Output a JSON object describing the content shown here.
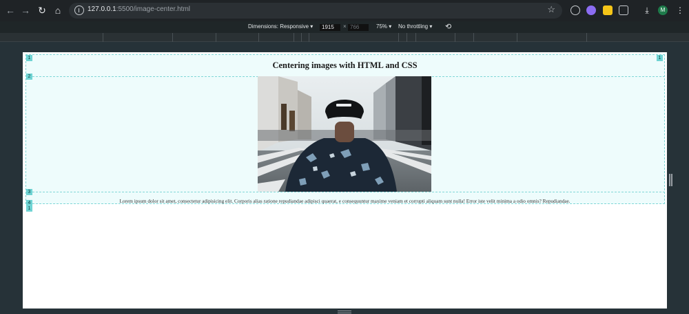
{
  "browser": {
    "url_host": "127.0.0.1",
    "url_rest": ":5500/image-center.html",
    "nav": {
      "back": "←",
      "forward": "→",
      "reload": "↻",
      "home": "⌂"
    },
    "profile_initial": "M"
  },
  "device_toolbar": {
    "dimensions_label": "Dimensions: Responsive",
    "width": "1915",
    "height": "766",
    "zoom": "75%",
    "throttling": "No throttling"
  },
  "page": {
    "title": "Centering images with HTML and CSS",
    "paragraph": "Lorem ipsum dolor sit amet, consectetur adipisicing elit. Corporis alias ratione repudiandae adipisci quaerat, e consequuntur maxime veniam et corrupti aliquam sunt nulla! Error iste velit minima a odio omnis? Repudiandae.",
    "image_alt": "person-in-city-street-photo",
    "overlay_badges": [
      "1",
      "1",
      "2",
      "3",
      "4",
      "1"
    ]
  },
  "colors": {
    "highlight_fill": "#eefcfc",
    "highlight_border": "#7fd6d6",
    "badge": "#6fd3d3"
  }
}
